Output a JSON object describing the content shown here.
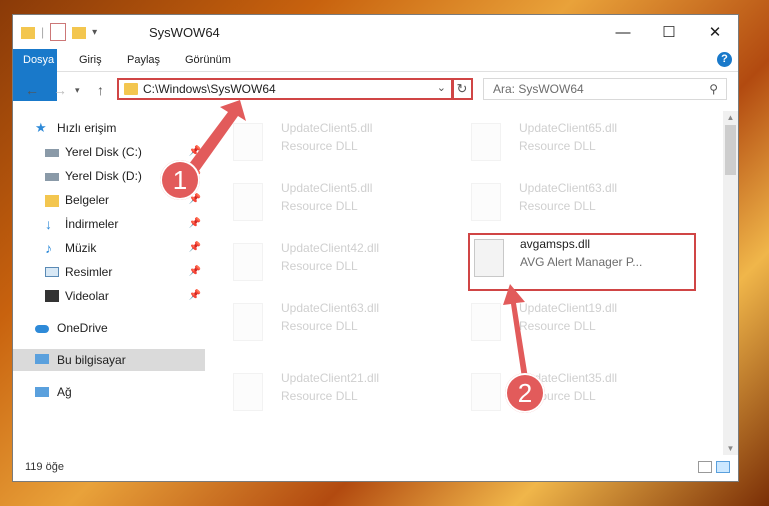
{
  "window": {
    "title": "SysWOW64",
    "controls": {
      "minimize": "—",
      "maximize": "☐",
      "close": "✕"
    }
  },
  "ribbon": {
    "tabs": [
      "Dosya",
      "Giriş",
      "Paylaş",
      "Görünüm"
    ],
    "help": "?"
  },
  "address": {
    "path": "C:\\Windows\\SysWOW64",
    "search_placeholder": "Ara: SysWOW64"
  },
  "sidebar": {
    "items": [
      {
        "label": "Hızlı erişim",
        "icon": "star-icon"
      },
      {
        "label": "Yerel Disk (C:)",
        "icon": "drive-icon"
      },
      {
        "label": "Yerel Disk (D:)",
        "icon": "drive-icon"
      },
      {
        "label": "Belgeler",
        "icon": "documents-icon"
      },
      {
        "label": "İndirmeler",
        "icon": "download-icon"
      },
      {
        "label": "Müzik",
        "icon": "music-icon"
      },
      {
        "label": "Resimler",
        "icon": "pictures-icon"
      },
      {
        "label": "Videolar",
        "icon": "video-icon"
      },
      {
        "label": "OneDrive",
        "icon": "cloud-icon"
      },
      {
        "label": "Bu bilgisayar",
        "icon": "computer-icon"
      },
      {
        "label": "Ağ",
        "icon": "network-icon"
      }
    ]
  },
  "files": [
    {
      "name": "UpdateClient5.dll",
      "desc": "Resource DLL"
    },
    {
      "name": "UpdateClient65.dll",
      "desc": "Resource DLL"
    },
    {
      "name": "UpdateClient5.dll",
      "desc": "Resource DLL"
    },
    {
      "name": "UpdateClient63.dll",
      "desc": "Resource DLL"
    },
    {
      "name": "UpdateClient42.dll",
      "desc": "Resource DLL"
    },
    {
      "name": "avgamsps.dll",
      "desc": "AVG Alert Manager P..."
    },
    {
      "name": "UpdateClient63.dll",
      "desc": "Resource DLL"
    },
    {
      "name": "UpdateClient19.dll",
      "desc": "Resource DLL"
    },
    {
      "name": "UpdateClient21.dll",
      "desc": "Resource DLL"
    },
    {
      "name": "UpdateClient35.dll",
      "desc": "Resource DLL"
    }
  ],
  "status": {
    "count": "119 öğe"
  },
  "callouts": [
    "1",
    "2"
  ],
  "colors": {
    "accent": "#1979ca",
    "highlight": "#d04545",
    "callout": "#e25b5b"
  }
}
